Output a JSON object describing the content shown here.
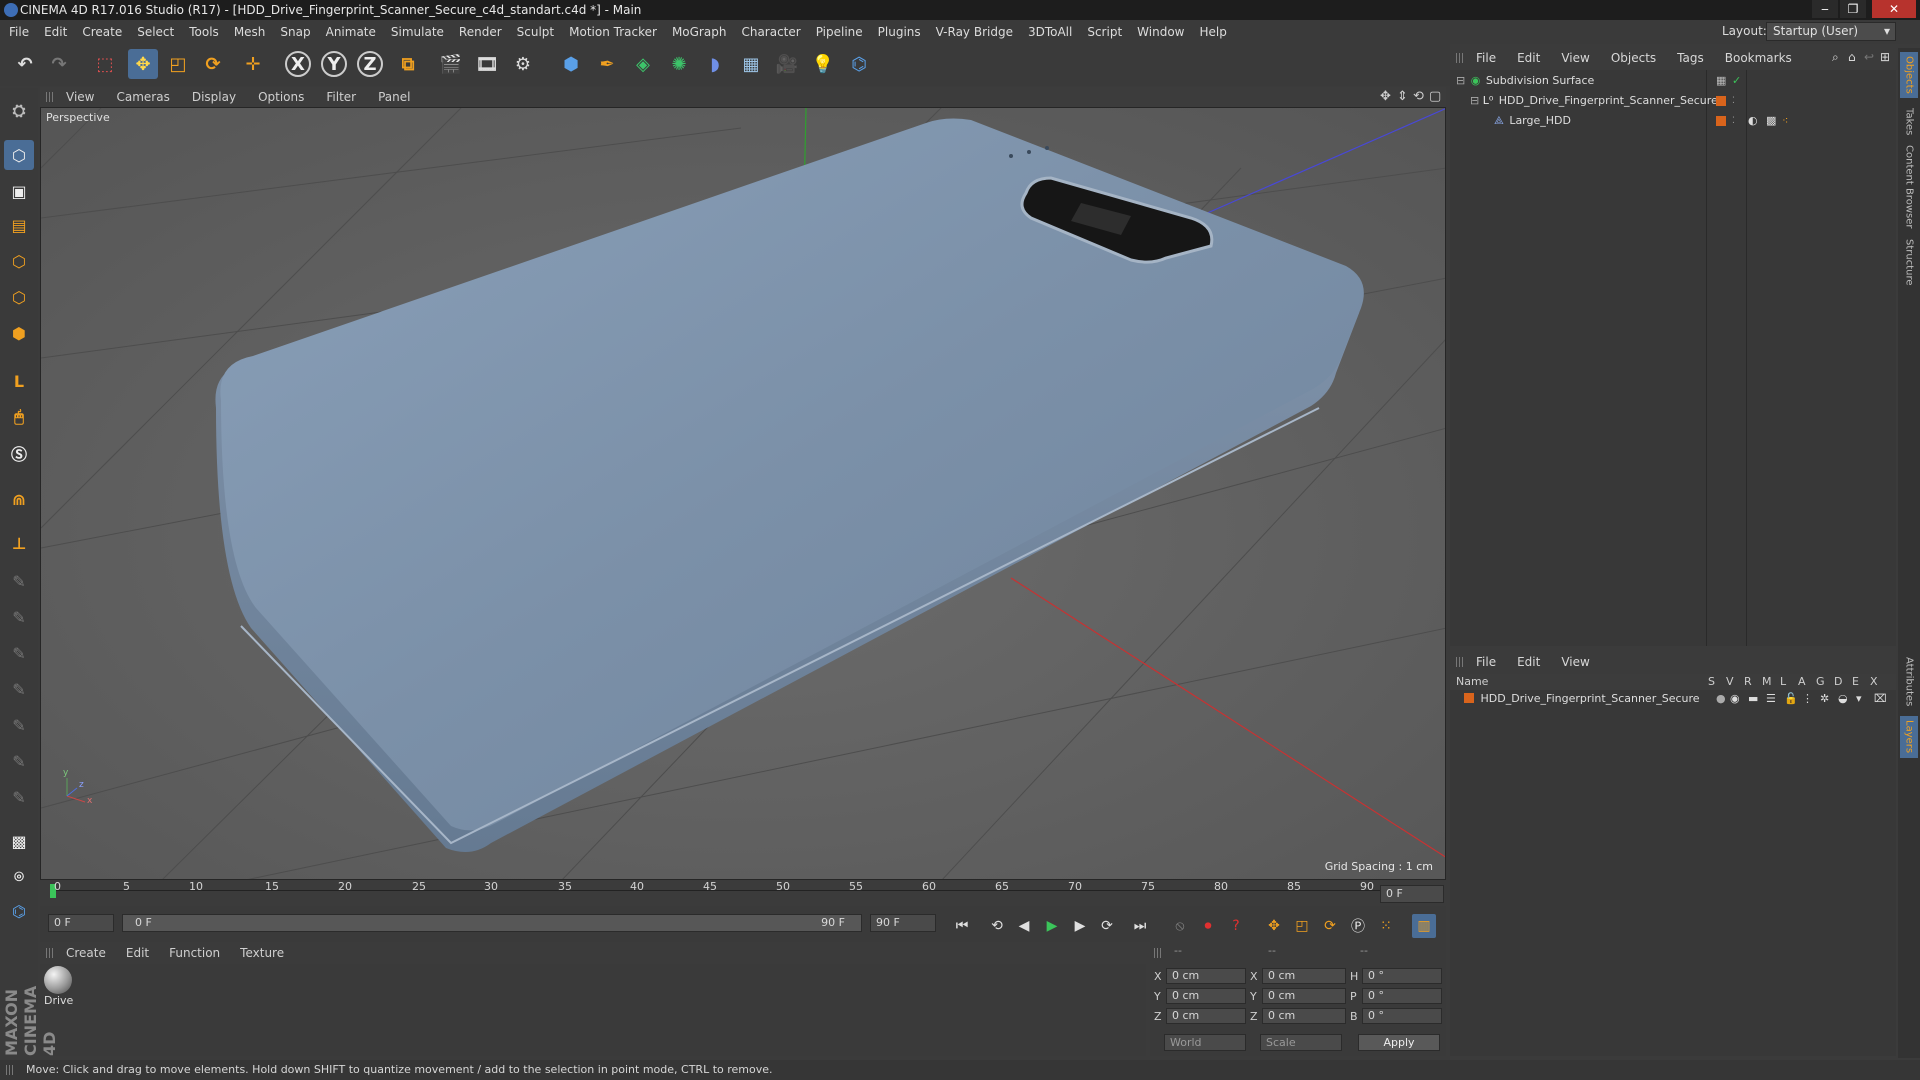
{
  "window": {
    "title": "CINEMA 4D R17.016 Studio (R17) - [HDD_Drive_Fingerprint_Scanner_Secure_c4d_standart.c4d *] - Main",
    "minimize": "‒",
    "maximize": "❐",
    "close": "✕"
  },
  "menubar": [
    "File",
    "Edit",
    "Create",
    "Select",
    "Tools",
    "Mesh",
    "Snap",
    "Animate",
    "Simulate",
    "Render",
    "Sculpt",
    "Motion Tracker",
    "MoGraph",
    "Character",
    "Pipeline",
    "Plugins",
    "V-Ray Bridge",
    "3DToAll",
    "Script",
    "Window",
    "Help"
  ],
  "layout": {
    "label": "Layout:",
    "value": "Startup (User)"
  },
  "toolbar": {
    "axis_x": "X",
    "axis_y": "Y",
    "axis_z": "Z"
  },
  "viewport": {
    "menu": [
      "View",
      "Cameras",
      "Display",
      "Options",
      "Filter",
      "Panel"
    ],
    "label": "Perspective",
    "grid_spacing": "Grid Spacing : 1 cm",
    "axis_x": "x",
    "axis_y": "y",
    "axis_z": "z"
  },
  "timeline": {
    "ticks": [
      "0",
      "5",
      "10",
      "15",
      "20",
      "25",
      "30",
      "35",
      "40",
      "45",
      "50",
      "55",
      "60",
      "65",
      "70",
      "75",
      "80",
      "85",
      "90"
    ],
    "end_field": "0 F"
  },
  "transport": {
    "current_frame": "0 F",
    "range_start": "0 F",
    "range_end": "90 F",
    "end_frame": "90 F"
  },
  "material_manager": {
    "menu": [
      "Create",
      "Edit",
      "Function",
      "Texture"
    ],
    "material_name": "Drive"
  },
  "coordinates": {
    "col_headers": [
      "--",
      "--",
      "--"
    ],
    "rows": [
      {
        "a": "X",
        "av": "0 cm",
        "b": "X",
        "bv": "0 cm",
        "c": "H",
        "cv": "0 °"
      },
      {
        "a": "Y",
        "av": "0 cm",
        "b": "Y",
        "bv": "0 cm",
        "c": "P",
        "cv": "0 °"
      },
      {
        "a": "Z",
        "av": "0 cm",
        "b": "Z",
        "bv": "0 cm",
        "c": "B",
        "cv": "0 °"
      }
    ],
    "mode": "World",
    "transform": "Scale",
    "apply": "Apply"
  },
  "object_manager": {
    "menu": [
      "File",
      "Edit",
      "View",
      "Objects",
      "Tags",
      "Bookmarks"
    ],
    "objects": [
      {
        "name": "Subdivision Surface",
        "indent": 0
      },
      {
        "name": "HDD_Drive_Fingerprint_Scanner_Secure",
        "indent": 1
      },
      {
        "name": "Large_HDD",
        "indent": 2
      }
    ]
  },
  "layer_manager": {
    "menu": [
      "File",
      "Edit",
      "View"
    ],
    "columns": [
      "Name",
      "S",
      "V",
      "R",
      "M",
      "L",
      "A",
      "G",
      "D",
      "E",
      "X"
    ],
    "layers": [
      {
        "name": "HDD_Drive_Fingerprint_Scanner_Secure",
        "color": "#d9641c"
      }
    ]
  },
  "right_tabs": [
    "Objects",
    "Takes",
    "Content Browser",
    "Structure",
    "Attributes",
    "Layers"
  ],
  "brand": "MAXON CINEMA 4D",
  "status": "Move: Click and drag to move elements. Hold down SHIFT to quantize movement / add to the selection in point mode, CTRL to remove.",
  "colors": {
    "accent_blue": "#4a84c4",
    "layer_orange": "#d9641c",
    "model_blue": "#7f94ad"
  }
}
